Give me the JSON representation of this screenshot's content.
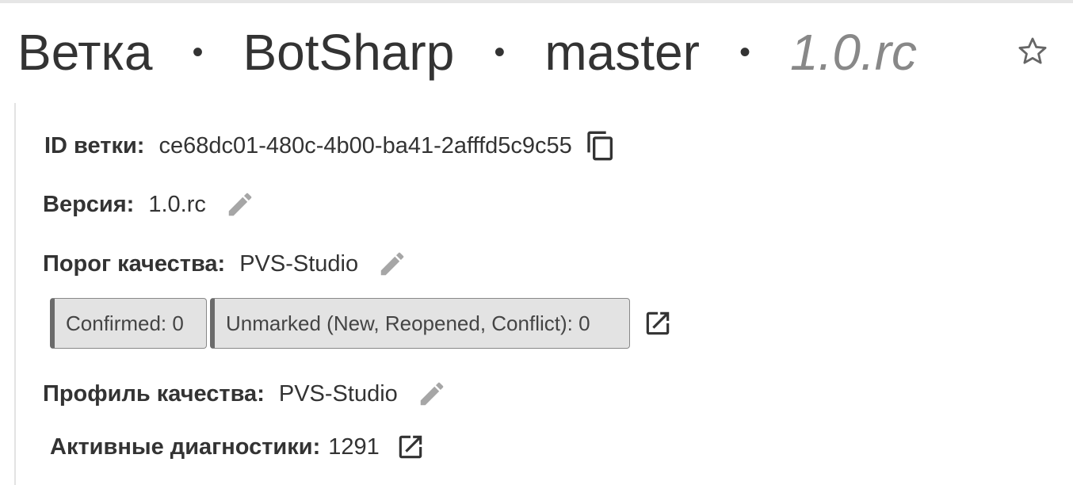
{
  "header": {
    "section": "Ветка",
    "project": "BotSharp",
    "branch": "master",
    "version": "1.0.rc",
    "separator": "•",
    "favorite_icon": "star-outline-icon"
  },
  "branch_id": {
    "label": "ID ветки:",
    "value": "ce68dc01-480c-4b00-ba41-2afffd5c9c55",
    "icon": "copy-icon"
  },
  "version": {
    "label": "Версия:",
    "value": "1.0.rc",
    "icon": "edit-pencil-icon"
  },
  "quality_gate": {
    "label": "Порог качества:",
    "value": "PVS-Studio",
    "icon": "edit-pencil-icon",
    "badges": [
      "Confirmed: 0",
      "Unmarked (New, Reopened, Conflict): 0"
    ],
    "link_icon": "open-in-new-icon"
  },
  "quality_profile": {
    "label": "Профиль качества:",
    "value": "PVS-Studio",
    "icon": "edit-pencil-icon"
  },
  "active_diagnostics": {
    "label": "Активные диагностики:",
    "value": "1291",
    "link_icon": "open-in-new-icon"
  },
  "colors": {
    "text": "#333333",
    "muted": "#888888",
    "icon_gray": "#a6a6a6",
    "badge_bg": "#e3e3e3",
    "badge_accent": "#6b6b6b"
  }
}
